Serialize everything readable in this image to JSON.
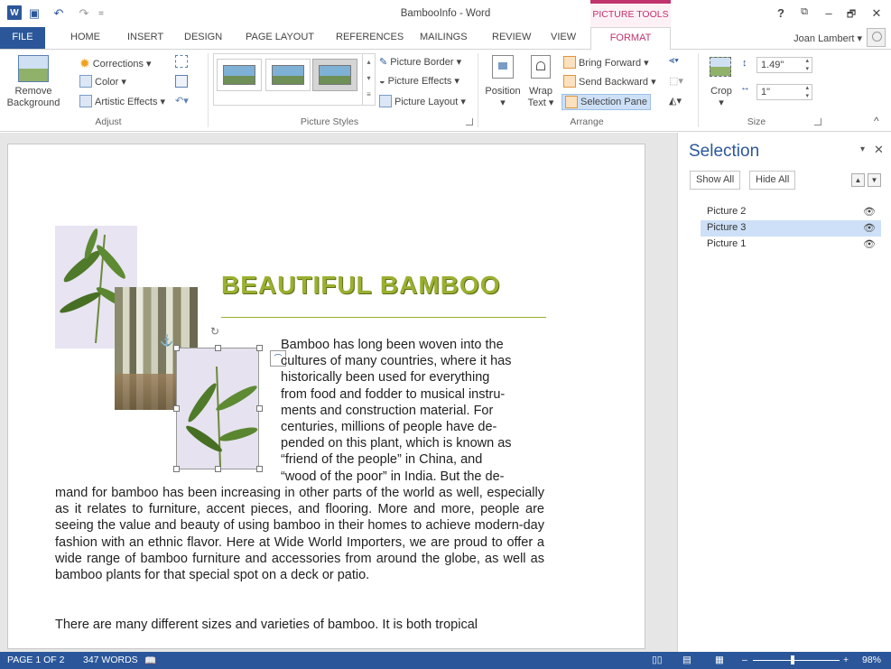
{
  "window": {
    "title": "BambooInfo - Word",
    "context_header": "PICTURE TOOLS"
  },
  "qat": {
    "save_glyph": "💾",
    "undo_glyph": "↶",
    "redo_glyph": "↷",
    "customize_glyph": "="
  },
  "window_controls": {
    "help": "?",
    "ribbon_display": "⧉",
    "minimize": "–",
    "restore": "🗗",
    "close": "✕"
  },
  "tabs": [
    {
      "label": "FILE"
    },
    {
      "label": "HOME"
    },
    {
      "label": "INSERT"
    },
    {
      "label": "DESIGN"
    },
    {
      "label": "PAGE LAYOUT"
    },
    {
      "label": "REFERENCES"
    },
    {
      "label": "MAILINGS"
    },
    {
      "label": "REVIEW"
    },
    {
      "label": "VIEW"
    },
    {
      "label": "FORMAT"
    }
  ],
  "user": {
    "name": "Joan Lambert ▾"
  },
  "ribbon": {
    "adjust": {
      "label": "Adjust",
      "remove_background": "Remove Background",
      "corrections": "Corrections ▾",
      "color": "Color ▾",
      "artistic_effects": "Artistic Effects ▾"
    },
    "picture_styles": {
      "label": "Picture Styles",
      "picture_border": "Picture Border ▾",
      "picture_effects": "Picture Effects ▾",
      "picture_layout": "Picture Layout ▾"
    },
    "arrange": {
      "label": "Arrange",
      "position": "Position",
      "wrap_text": "Wrap Text ▾",
      "bring_forward": "Bring Forward ▾",
      "send_backward": "Send Backward ▾",
      "selection_pane": "Selection Pane"
    },
    "size": {
      "label": "Size",
      "crop": "Crop",
      "height": "1.49\"",
      "width": "1\""
    },
    "collapse": "^"
  },
  "document": {
    "heading": "BEAUTIFUL BAMBOO",
    "para1_lines": [
      "Bamboo has long been woven into the",
      "cultures of many countries, where it has",
      "historically been used for everything",
      "from food and fodder to musical instru-",
      "ments and construction material. For",
      "centuries, millions of people have de-",
      "pended on this plant, which is known as",
      "“friend of the people” in China, and",
      "“wood of the poor” in India. But the de-"
    ],
    "para1_full": "mand for bamboo has been increasing in other parts of the world as well, especially as it relates to furniture, accent pieces, and flooring. More and more, people are seeing the value and beauty of using bamboo in their homes to achieve modern-day fashion with an ethnic flavor. Here at Wide World Importers, we are proud to offer a wide range of bamboo furniture and accessories from around the globe, as well as bamboo plants for that special spot on a deck or patio.",
    "para2": "There are many different sizes and varieties of bamboo. It is both tropical"
  },
  "selection_pane": {
    "title": "Selection",
    "show_all": "Show All",
    "hide_all": "Hide All",
    "items": [
      {
        "label": "Picture 2",
        "selected": false
      },
      {
        "label": "Picture 3",
        "selected": true
      },
      {
        "label": "Picture 1",
        "selected": false
      }
    ]
  },
  "status": {
    "page": "PAGE 1 OF 2",
    "words": "347 WORDS",
    "zoom": "98%"
  },
  "colors": {
    "word_blue": "#2b579a",
    "picture_tools": "#c0336e",
    "heading_green": "#9ab030"
  }
}
